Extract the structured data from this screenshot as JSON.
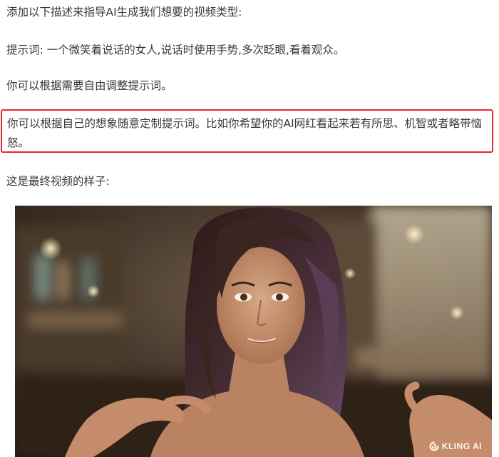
{
  "article": {
    "intro": "添加以下描述来指导AI生成我们想要的视频类型:",
    "prompt_line": "提示词: 一个微笑着说话的女人,说话时使用手势,多次眨眼,看着观众。",
    "adjust_tip": "你可以根据需要自由调整提示词。",
    "highlight_tip": "你可以根据自己的想象随意定制提示词。比如你希望你的AI网红看起来若有所思、机智或者略带恼怒。",
    "result_caption": "这是最终视频的样子:"
  },
  "video": {
    "watermark_text": "KLING AI",
    "watermark_icon": "kling-logo-icon"
  },
  "colors": {
    "highlight_border": "#e8263a",
    "text": "#383838"
  }
}
